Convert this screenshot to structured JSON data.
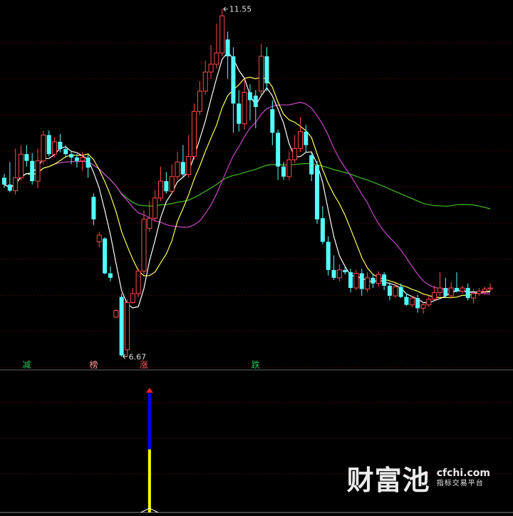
{
  "chart_data": {
    "type": "candlestick",
    "price_annotations": {
      "high": "11.55",
      "low": "6.67"
    },
    "signal_labels": [
      {
        "text": "减",
        "index": 4,
        "color": "#22c55e"
      },
      {
        "text": "榜",
        "index": 16,
        "color": "#ff9a9a"
      },
      {
        "text": "涨",
        "index": 25,
        "color": "#ff5b5b"
      },
      {
        "text": "跌",
        "index": 45,
        "color": "#22c55e"
      }
    ],
    "candles": [
      [
        8.54,
        8.42,
        8.36,
        8.61
      ],
      [
        8.42,
        8.31,
        8.28,
        8.82
      ],
      [
        8.31,
        8.54,
        8.24,
        9.06
      ],
      [
        8.54,
        8.96,
        8.5,
        9.12
      ],
      [
        8.96,
        8.84,
        8.74,
        9.12
      ],
      [
        8.84,
        8.48,
        8.42,
        8.98
      ],
      [
        8.48,
        8.84,
        8.36,
        9.06
      ],
      [
        8.84,
        9.3,
        8.78,
        9.38
      ],
      [
        9.3,
        8.96,
        8.92,
        9.38
      ],
      [
        8.96,
        9.18,
        8.9,
        9.26
      ],
      [
        9.18,
        9.05,
        8.99,
        9.32
      ],
      [
        9.05,
        8.96,
        8.9,
        9.12
      ],
      [
        8.96,
        8.9,
        8.78,
        9.0
      ],
      [
        8.9,
        8.84,
        8.72,
        8.96
      ],
      [
        8.84,
        8.9,
        8.66,
        9.0
      ],
      [
        8.9,
        8.72,
        8.54,
        8.96
      ],
      [
        8.2,
        7.8,
        7.7,
        8.26
      ],
      [
        7.4,
        7.52,
        7.3,
        7.58
      ],
      [
        7.46,
        6.84,
        6.82,
        7.48
      ],
      [
        6.84,
        6.76,
        6.7,
        6.96
      ],
      [
        6.06,
        6.18,
        6.04,
        6.2
      ],
      [
        6.42,
        5.38,
        5.36,
        6.48
      ],
      [
        5.48,
        6.32,
        5.36,
        6.38
      ],
      [
        6.32,
        6.48,
        6.3,
        6.58
      ],
      [
        6.48,
        6.88,
        6.42,
        6.92
      ],
      [
        6.88,
        7.8,
        6.82,
        7.96
      ],
      [
        7.64,
        7.82,
        7.58,
        8.12
      ],
      [
        7.82,
        8.18,
        7.76,
        8.32
      ],
      [
        8.18,
        8.48,
        8.12,
        8.74
      ],
      [
        8.48,
        8.3,
        8.26,
        8.64
      ],
      [
        8.3,
        8.56,
        8.24,
        8.78
      ],
      [
        8.56,
        8.82,
        8.5,
        9.0
      ],
      [
        8.82,
        8.6,
        8.56,
        9.12
      ],
      [
        8.6,
        8.92,
        8.54,
        9.3
      ],
      [
        8.92,
        9.72,
        8.86,
        9.86
      ],
      [
        9.72,
        10.08,
        9.66,
        10.26
      ],
      [
        10.08,
        10.42,
        10.02,
        10.62
      ],
      [
        10.42,
        10.56,
        10.3,
        10.9
      ],
      [
        10.56,
        10.76,
        10.48,
        11.28
      ],
      [
        10.76,
        11.42,
        10.7,
        11.54
      ],
      [
        11.0,
        10.7,
        10.3,
        11.14
      ],
      [
        10.7,
        9.86,
        9.34,
        10.86
      ],
      [
        9.86,
        9.5,
        9.36,
        10.1
      ],
      [
        9.5,
        10.06,
        9.4,
        10.3
      ],
      [
        10.06,
        9.92,
        9.56,
        10.2
      ],
      [
        10.0,
        9.8,
        9.42,
        10.1
      ],
      [
        10.08,
        10.7,
        10.0,
        10.92
      ],
      [
        10.7,
        10.22,
        10.08,
        10.86
      ],
      [
        9.76,
        9.34,
        9.12,
        9.92
      ],
      [
        9.34,
        8.74,
        8.5,
        9.4
      ],
      [
        8.74,
        8.56,
        8.5,
        8.82
      ],
      [
        8.56,
        8.86,
        8.5,
        9.0
      ],
      [
        8.86,
        9.06,
        8.8,
        9.3
      ],
      [
        9.06,
        9.36,
        9.0,
        9.62
      ],
      [
        9.36,
        9.12,
        9.0,
        9.48
      ],
      [
        8.94,
        8.6,
        8.48,
        8.98
      ],
      [
        8.76,
        7.8,
        7.72,
        8.84
      ],
      [
        7.82,
        7.4,
        7.36,
        8.04
      ],
      [
        7.4,
        6.9,
        6.8,
        7.5
      ],
      [
        6.9,
        6.76,
        6.72,
        7.16
      ],
      [
        6.76,
        6.9,
        6.7,
        7.0
      ],
      [
        6.9,
        6.86,
        6.82,
        6.96
      ],
      [
        6.86,
        6.58,
        6.5,
        6.92
      ],
      [
        6.58,
        6.84,
        6.54,
        6.9
      ],
      [
        6.84,
        6.56,
        6.44,
        6.92
      ],
      [
        6.56,
        6.76,
        6.5,
        6.86
      ],
      [
        6.76,
        6.66,
        6.58,
        6.82
      ],
      [
        6.66,
        6.82,
        6.6,
        6.88
      ],
      [
        6.82,
        6.62,
        6.54,
        6.86
      ],
      [
        6.62,
        6.44,
        6.36,
        6.68
      ],
      [
        6.44,
        6.6,
        6.4,
        6.66
      ],
      [
        6.6,
        6.42,
        6.4,
        6.66
      ],
      [
        6.42,
        6.28,
        6.26,
        6.48
      ],
      [
        6.28,
        6.4,
        6.24,
        6.44
      ],
      [
        6.4,
        6.22,
        6.14,
        6.46
      ],
      [
        6.22,
        6.28,
        6.12,
        6.32
      ],
      [
        6.28,
        6.38,
        6.24,
        6.44
      ],
      [
        6.38,
        6.5,
        6.36,
        6.62
      ],
      [
        6.5,
        6.58,
        6.44,
        6.86
      ],
      [
        6.58,
        6.44,
        6.4,
        6.76
      ],
      [
        6.44,
        6.58,
        6.4,
        6.68
      ],
      [
        6.58,
        6.52,
        6.5,
        6.86
      ],
      [
        6.52,
        6.58,
        6.48,
        6.62
      ],
      [
        6.58,
        6.4,
        6.36,
        6.66
      ],
      [
        6.4,
        6.48,
        6.3,
        6.56
      ],
      [
        6.48,
        6.52,
        6.44,
        6.58
      ],
      [
        6.52,
        6.56,
        6.46,
        6.6
      ],
      [
        6.56,
        6.58,
        6.52,
        6.66
      ]
    ],
    "signal_bar": {
      "index": 26,
      "values": [
        0.53,
        1.0
      ],
      "colors": [
        "#ffff00",
        "#0000ff"
      ]
    }
  },
  "watermark": {
    "main": "财富池",
    "domain": "cfchi.com",
    "tagline": "指标交易平台"
  },
  "colors": {
    "up": "#ff4a4a",
    "down": "#54ffff",
    "ma5": "#ffffff",
    "ma10": "#ffff55",
    "ma20": "#cc44cc",
    "ma60": "#44bb22",
    "grid": "#7a1010",
    "divider": "#666"
  }
}
